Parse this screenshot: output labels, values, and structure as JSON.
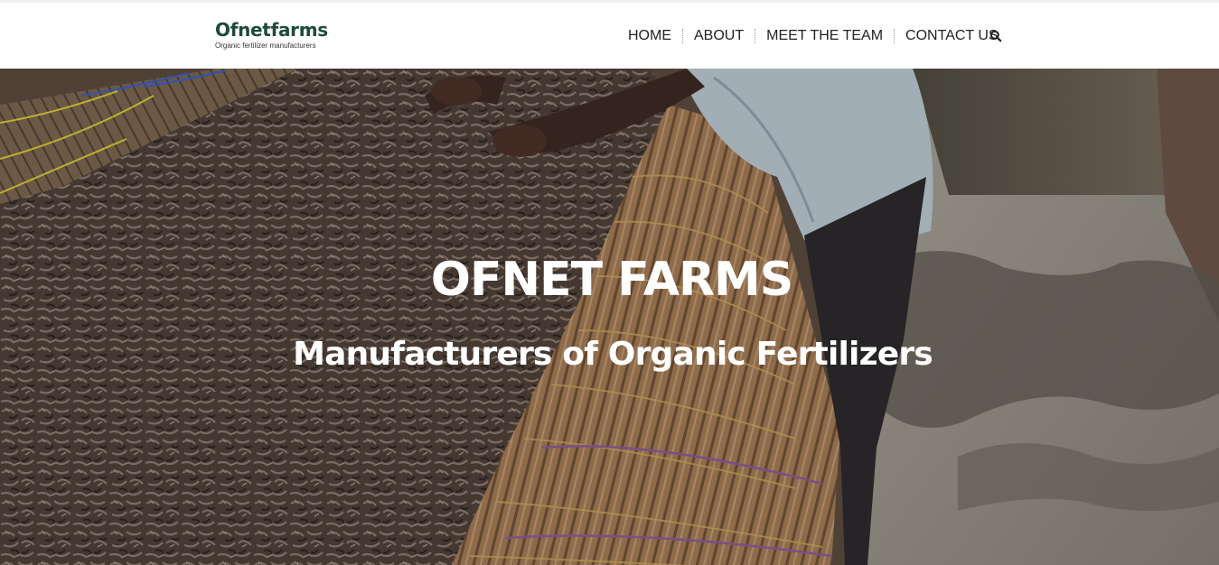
{
  "brand": {
    "name": "Ofnetfarms",
    "tagline": "Organic fertilizer manufacturers"
  },
  "nav": {
    "items": [
      {
        "label": "HOME"
      },
      {
        "label": "ABOUT"
      },
      {
        "label": "MEET THE TEAM"
      },
      {
        "label": "CONTACT US"
      }
    ],
    "search_icon": "search-icon"
  },
  "hero": {
    "title": "OFNET FARMS",
    "subtitle": "Manufacturers of Organic Fertilizers"
  },
  "colors": {
    "brand": "#1e4a3c",
    "nav_text": "#222222",
    "hero_text": "#ffffff"
  }
}
